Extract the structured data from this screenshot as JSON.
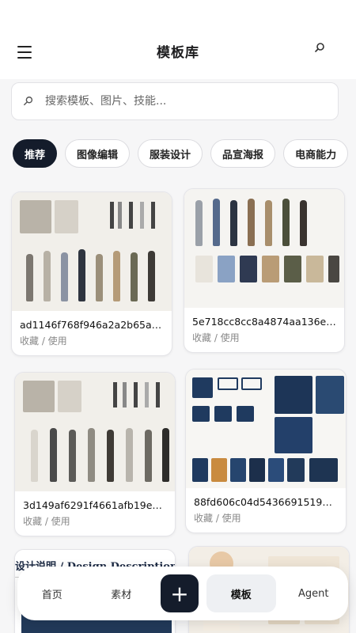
{
  "header": {
    "title": "模板库"
  },
  "search": {
    "placeholder": "搜索模板、图片、技能..."
  },
  "tabs": [
    {
      "label": "推荐",
      "active": true
    },
    {
      "label": "图像编辑"
    },
    {
      "label": "服装设计"
    },
    {
      "label": "品宣海报"
    },
    {
      "label": "电商能力"
    }
  ],
  "cards": [
    {
      "name": "ad1146f768f946a2a2b65af0...",
      "actions": "收藏 / 使用"
    },
    {
      "name": "5e718cc8cc8a4874aa136e4...",
      "actions": "收藏 / 使用"
    },
    {
      "name": "3d149af6291f4661afb19e62...",
      "actions": "收藏 / 使用"
    },
    {
      "name": "88fd606c04d543669151985...",
      "actions": "收藏 / 使用"
    },
    {
      "name": "",
      "actions": "",
      "thumb_text": "设计说明 / Design Description"
    },
    {
      "name": "",
      "actions": ""
    }
  ],
  "bottom_nav": {
    "items": [
      {
        "label": "首页"
      },
      {
        "label": "素材"
      },
      {
        "label": "+"
      },
      {
        "label": "模板",
        "active": true
      },
      {
        "label": "Agent"
      }
    ]
  },
  "colors": {
    "accent": "#141c2b",
    "background": "#f6f6f7"
  }
}
